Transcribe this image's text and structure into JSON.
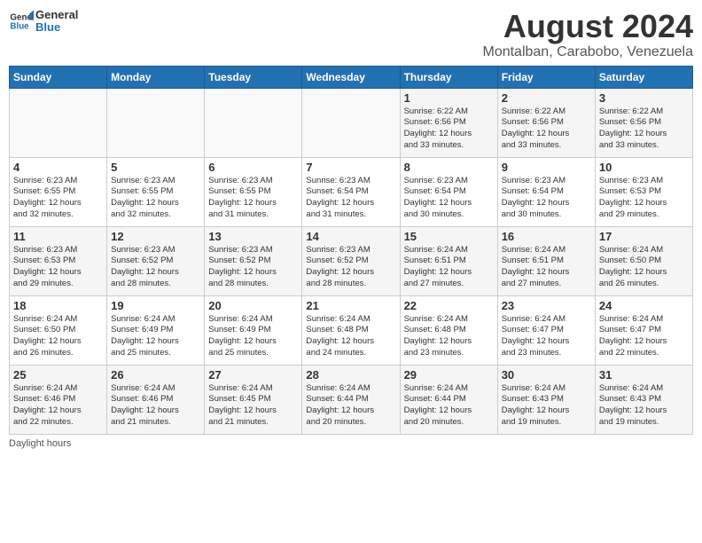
{
  "header": {
    "logo_line1": "General",
    "logo_line2": "Blue",
    "title": "August 2024",
    "subtitle": "Montalban, Carabobo, Venezuela"
  },
  "days_of_week": [
    "Sunday",
    "Monday",
    "Tuesday",
    "Wednesday",
    "Thursday",
    "Friday",
    "Saturday"
  ],
  "weeks": [
    [
      {
        "day": "",
        "info": ""
      },
      {
        "day": "",
        "info": ""
      },
      {
        "day": "",
        "info": ""
      },
      {
        "day": "",
        "info": ""
      },
      {
        "day": "1",
        "info": "Sunrise: 6:22 AM\nSunset: 6:56 PM\nDaylight: 12 hours\nand 33 minutes."
      },
      {
        "day": "2",
        "info": "Sunrise: 6:22 AM\nSunset: 6:56 PM\nDaylight: 12 hours\nand 33 minutes."
      },
      {
        "day": "3",
        "info": "Sunrise: 6:22 AM\nSunset: 6:56 PM\nDaylight: 12 hours\nand 33 minutes."
      }
    ],
    [
      {
        "day": "4",
        "info": "Sunrise: 6:23 AM\nSunset: 6:55 PM\nDaylight: 12 hours\nand 32 minutes."
      },
      {
        "day": "5",
        "info": "Sunrise: 6:23 AM\nSunset: 6:55 PM\nDaylight: 12 hours\nand 32 minutes."
      },
      {
        "day": "6",
        "info": "Sunrise: 6:23 AM\nSunset: 6:55 PM\nDaylight: 12 hours\nand 31 minutes."
      },
      {
        "day": "7",
        "info": "Sunrise: 6:23 AM\nSunset: 6:54 PM\nDaylight: 12 hours\nand 31 minutes."
      },
      {
        "day": "8",
        "info": "Sunrise: 6:23 AM\nSunset: 6:54 PM\nDaylight: 12 hours\nand 30 minutes."
      },
      {
        "day": "9",
        "info": "Sunrise: 6:23 AM\nSunset: 6:54 PM\nDaylight: 12 hours\nand 30 minutes."
      },
      {
        "day": "10",
        "info": "Sunrise: 6:23 AM\nSunset: 6:53 PM\nDaylight: 12 hours\nand 29 minutes."
      }
    ],
    [
      {
        "day": "11",
        "info": "Sunrise: 6:23 AM\nSunset: 6:53 PM\nDaylight: 12 hours\nand 29 minutes."
      },
      {
        "day": "12",
        "info": "Sunrise: 6:23 AM\nSunset: 6:52 PM\nDaylight: 12 hours\nand 28 minutes."
      },
      {
        "day": "13",
        "info": "Sunrise: 6:23 AM\nSunset: 6:52 PM\nDaylight: 12 hours\nand 28 minutes."
      },
      {
        "day": "14",
        "info": "Sunrise: 6:23 AM\nSunset: 6:52 PM\nDaylight: 12 hours\nand 28 minutes."
      },
      {
        "day": "15",
        "info": "Sunrise: 6:24 AM\nSunset: 6:51 PM\nDaylight: 12 hours\nand 27 minutes."
      },
      {
        "day": "16",
        "info": "Sunrise: 6:24 AM\nSunset: 6:51 PM\nDaylight: 12 hours\nand 27 minutes."
      },
      {
        "day": "17",
        "info": "Sunrise: 6:24 AM\nSunset: 6:50 PM\nDaylight: 12 hours\nand 26 minutes."
      }
    ],
    [
      {
        "day": "18",
        "info": "Sunrise: 6:24 AM\nSunset: 6:50 PM\nDaylight: 12 hours\nand 26 minutes."
      },
      {
        "day": "19",
        "info": "Sunrise: 6:24 AM\nSunset: 6:49 PM\nDaylight: 12 hours\nand 25 minutes."
      },
      {
        "day": "20",
        "info": "Sunrise: 6:24 AM\nSunset: 6:49 PM\nDaylight: 12 hours\nand 25 minutes."
      },
      {
        "day": "21",
        "info": "Sunrise: 6:24 AM\nSunset: 6:48 PM\nDaylight: 12 hours\nand 24 minutes."
      },
      {
        "day": "22",
        "info": "Sunrise: 6:24 AM\nSunset: 6:48 PM\nDaylight: 12 hours\nand 23 minutes."
      },
      {
        "day": "23",
        "info": "Sunrise: 6:24 AM\nSunset: 6:47 PM\nDaylight: 12 hours\nand 23 minutes."
      },
      {
        "day": "24",
        "info": "Sunrise: 6:24 AM\nSunset: 6:47 PM\nDaylight: 12 hours\nand 22 minutes."
      }
    ],
    [
      {
        "day": "25",
        "info": "Sunrise: 6:24 AM\nSunset: 6:46 PM\nDaylight: 12 hours\nand 22 minutes."
      },
      {
        "day": "26",
        "info": "Sunrise: 6:24 AM\nSunset: 6:46 PM\nDaylight: 12 hours\nand 21 minutes."
      },
      {
        "day": "27",
        "info": "Sunrise: 6:24 AM\nSunset: 6:45 PM\nDaylight: 12 hours\nand 21 minutes."
      },
      {
        "day": "28",
        "info": "Sunrise: 6:24 AM\nSunset: 6:44 PM\nDaylight: 12 hours\nand 20 minutes."
      },
      {
        "day": "29",
        "info": "Sunrise: 6:24 AM\nSunset: 6:44 PM\nDaylight: 12 hours\nand 20 minutes."
      },
      {
        "day": "30",
        "info": "Sunrise: 6:24 AM\nSunset: 6:43 PM\nDaylight: 12 hours\nand 19 minutes."
      },
      {
        "day": "31",
        "info": "Sunrise: 6:24 AM\nSunset: 6:43 PM\nDaylight: 12 hours\nand 19 minutes."
      }
    ]
  ],
  "footer": {
    "note": "Daylight hours"
  }
}
